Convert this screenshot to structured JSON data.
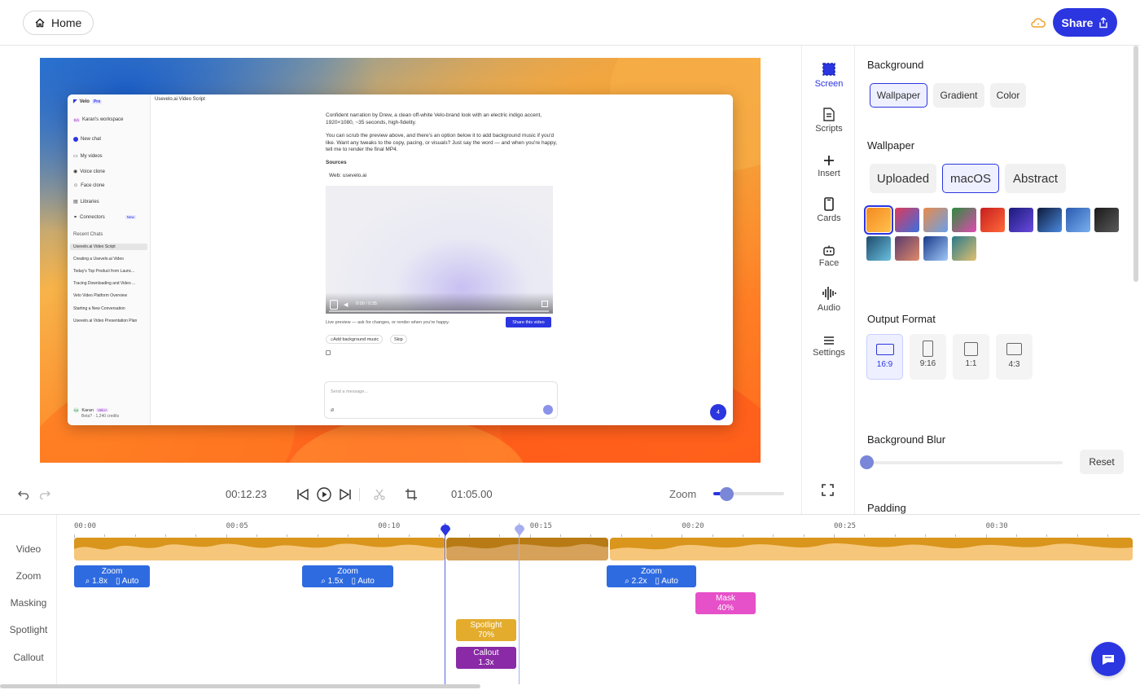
{
  "header": {
    "home_label": "Home",
    "share_label": "Share"
  },
  "preview": {
    "sidebar": {
      "brand": "Velo",
      "brand_badge": "Pro",
      "workspace": "Karan's workspace",
      "workspace_initials": "KA",
      "items": [
        "New chat",
        "My videos",
        "Voice clone",
        "Face clone",
        "Libraries",
        "Connectors"
      ],
      "connectors_badge": "New",
      "recent_heading": "Recent Chats",
      "recent": [
        "Usevelo.ai Video Script",
        "Creating a Usevelo.ai Video",
        "Today's Top Product from Launc...",
        "Tracing Downloading and Video ...",
        "Velo Video Platform Overview",
        "Starting a New Conversation",
        "Usevelo.ai Video Presentation Plan"
      ],
      "user_name": "Karan",
      "user_badge": "Velo+",
      "user_credits": "Beta? · 1,240 credits",
      "user_initials": "KA"
    },
    "window_title": "Usevelo.ai Video Script",
    "para1": "Confident narration by Drew, a clean off-white Velo-brand look with an electric indigo accent, 1920×1080, ~35 seconds, high-fidelity.",
    "para2": "You can scrub the preview above, and there's an option below it to add background music if you'd like. Want any tweaks to the copy, pacing, or visuals? Just say the word — and when you're happy, tell me to render the final MP4.",
    "sources_heading": "Sources",
    "source_item": "Web: usevelo.ai",
    "video_time": "0:00 / 0:35",
    "preview_note": "Live preview — ask for changes, or render when you're happy.",
    "share_video_label": "Share this video",
    "add_music_label": "Add background music",
    "skip_label": "Skip",
    "message_placeholder": "Send a message...",
    "mini_fab": "4"
  },
  "tools": [
    {
      "label": "Screen",
      "icon": "screen-icon",
      "active": true
    },
    {
      "label": "Scripts",
      "icon": "scripts-icon"
    },
    {
      "label": "Insert",
      "icon": "plus-icon"
    },
    {
      "label": "Cards",
      "icon": "cards-icon"
    },
    {
      "label": "Face",
      "icon": "face-icon"
    },
    {
      "label": "Audio",
      "icon": "audio-icon"
    },
    {
      "label": "Settings",
      "icon": "menu-icon"
    }
  ],
  "panel": {
    "background_heading": "Background",
    "background_tabs": [
      "Wallpaper",
      "Gradient",
      "Color"
    ],
    "background_active": "Wallpaper",
    "wallpaper_heading": "Wallpaper",
    "wallpaper_tabs": [
      "Uploaded",
      "macOS",
      "Abstract"
    ],
    "wallpaper_active": "macOS",
    "thumb_colors": [
      [
        "#f58a1f",
        "#ffc04d"
      ],
      [
        "#e0395a",
        "#3a6fe0"
      ],
      [
        "#e88a4a",
        "#6aa0e8"
      ],
      [
        "#2e8b3e",
        "#e04bb0"
      ],
      [
        "#c81e1e",
        "#ff6a3a"
      ],
      [
        "#1a1a7a",
        "#6a4ae0"
      ],
      [
        "#0e1a3a",
        "#4a8ae0"
      ],
      [
        "#2a5ab0",
        "#7ab0f0"
      ],
      [
        "#1a1a1a",
        "#5a5a5a"
      ],
      [
        "#1e4a6a",
        "#6ac0e0"
      ],
      [
        "#5a3a6a",
        "#e08a6a"
      ],
      [
        "#1a3a8a",
        "#a0c8f8"
      ],
      [
        "#2a7a8a",
        "#e0c070"
      ]
    ],
    "output_heading": "Output Format",
    "formats": [
      "16:9",
      "9:16",
      "1:1",
      "4:3"
    ],
    "format_active": "16:9",
    "blur_heading": "Background Blur",
    "blur_value": 0,
    "reset_label": "Reset",
    "padding_heading": "Padding"
  },
  "controls": {
    "current_time": "00:12.23",
    "total_time": "01:05.00",
    "zoom_label": "Zoom",
    "zoom_level": 0.2
  },
  "timeline": {
    "tracks": [
      "Video",
      "Zoom",
      "Masking",
      "Spotlight",
      "Callout"
    ],
    "ticks": [
      "00:00",
      "00:05",
      "00:10",
      "00:15",
      "00:20",
      "00:25",
      "00:30"
    ],
    "zoom_clips": [
      {
        "title": "Zoom",
        "scale": "1.8x",
        "mode": "Auto"
      },
      {
        "title": "Zoom",
        "scale": "1.5x",
        "mode": "Auto"
      },
      {
        "title": "Zoom",
        "scale": "2.2x",
        "mode": "Auto"
      }
    ],
    "mask_clip": {
      "title": "Mask",
      "value": "40%"
    },
    "spotlight_clip": {
      "title": "Spotlight",
      "value": "70%"
    },
    "callout_clip": {
      "title": "Callout",
      "value": "1.3x"
    },
    "colors": {
      "accent": "#2b35e0",
      "video": "#d9951c",
      "zoom": "#2f6be0",
      "mask": "#e650c8",
      "spotlight": "#e3ac2c",
      "callout": "#8a2aa6"
    }
  }
}
